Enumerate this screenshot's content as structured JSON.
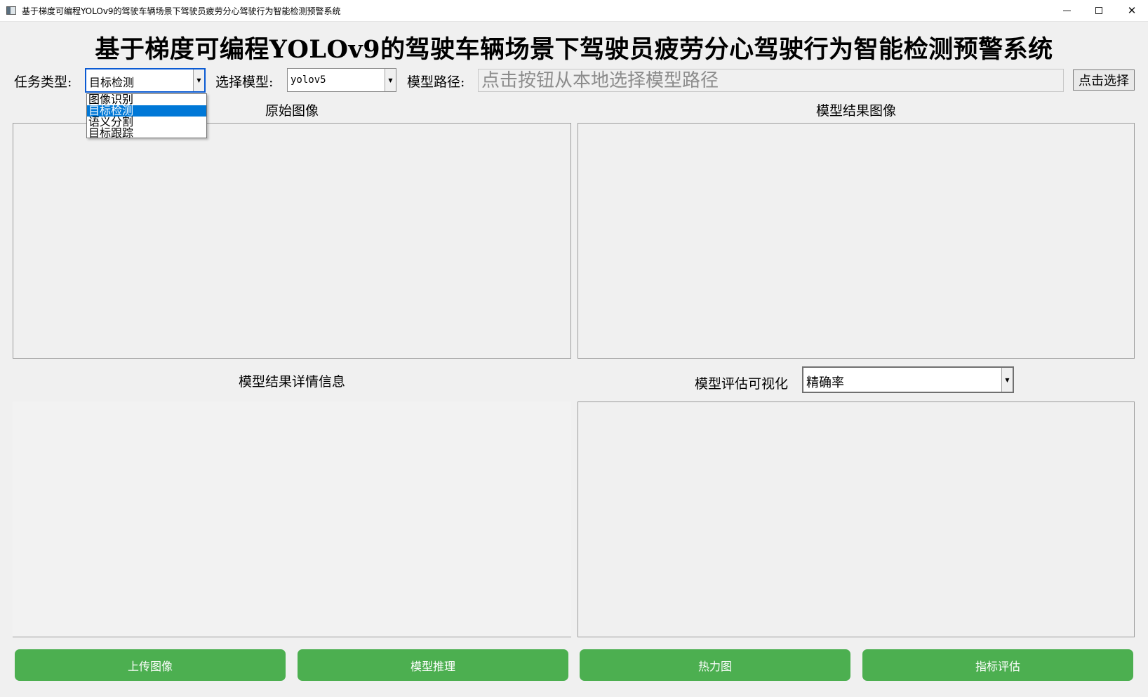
{
  "window": {
    "title": "基于梯度可编程YOLOv9的驾驶车辆场景下驾驶员疲劳分心驾驶行为智能检测预警系统",
    "minimize": "—",
    "maximize": "☐",
    "close": "✕"
  },
  "header": {
    "title": "基于梯度可编程YOLOv9的驾驶车辆场景下驾驶员疲劳分心驾驶行为智能检测预警系统"
  },
  "toolbar": {
    "task_label": "任务类型:",
    "task_value": "目标检测",
    "task_options": [
      "图像识别",
      "目标检测",
      "语义分割",
      "目标跟踪"
    ],
    "model_label": "选择模型:",
    "model_value": "yolov5",
    "path_label": "模型路径:",
    "path_placeholder": "点击按钮从本地选择模型路径",
    "choose_button": "点击选择"
  },
  "panels": {
    "original_label": "原始图像",
    "result_label": "模型结果图像",
    "details_label": "模型结果详情信息",
    "eval_label": "模型评估可视化",
    "eval_metric": "精确率"
  },
  "actions": {
    "upload": "上传图像",
    "infer": "模型推理",
    "heatmap": "热力图",
    "evaluate": "指标评估"
  },
  "colors": {
    "action_green": "#4caf50",
    "selection_blue": "#0078d7"
  }
}
